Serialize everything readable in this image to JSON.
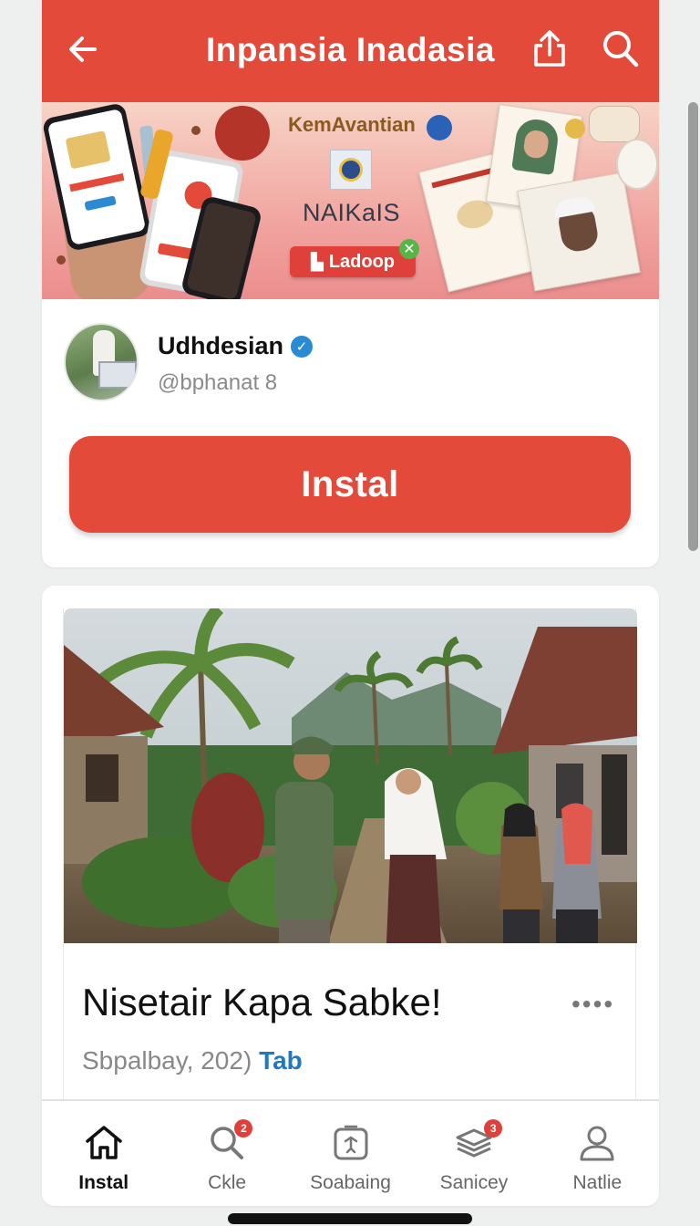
{
  "app_bar": {
    "title": "Inpansia Inadasia",
    "back_icon": "arrow-left-icon",
    "share_icon": "share-icon",
    "search_icon": "search-icon",
    "color": "#e34a3a"
  },
  "banner": {
    "headline": "KemAvantian",
    "subtitle": "NAIKaIS",
    "button_label": "Ladoop",
    "button_icon": "logo-mark-icon",
    "close_icon": "close-icon"
  },
  "profile": {
    "name": "Udhdesian",
    "verified_icon": "verified-check-icon",
    "handle": "@bphanat 8",
    "install_label": "Instal"
  },
  "post": {
    "title": "Nisetair Kapa Sabke!",
    "more_label": "••••",
    "meta_prefix": "Sbpalbay, 202)",
    "meta_tag": "Tab"
  },
  "tab_bar": {
    "items": [
      {
        "label": "Instal",
        "icon": "home-icon",
        "active": true
      },
      {
        "label": "Ckle",
        "icon": "search-icon",
        "badge": "2"
      },
      {
        "label": "Soabaing",
        "icon": "pin-card-icon"
      },
      {
        "label": "Sanicey",
        "icon": "inbox-stack-icon",
        "badge": "3"
      },
      {
        "label": "Natlie",
        "icon": "person-icon"
      }
    ]
  },
  "colors": {
    "accent": "#e34a3a",
    "link": "#1f78c4",
    "background": "#eef0ef"
  }
}
